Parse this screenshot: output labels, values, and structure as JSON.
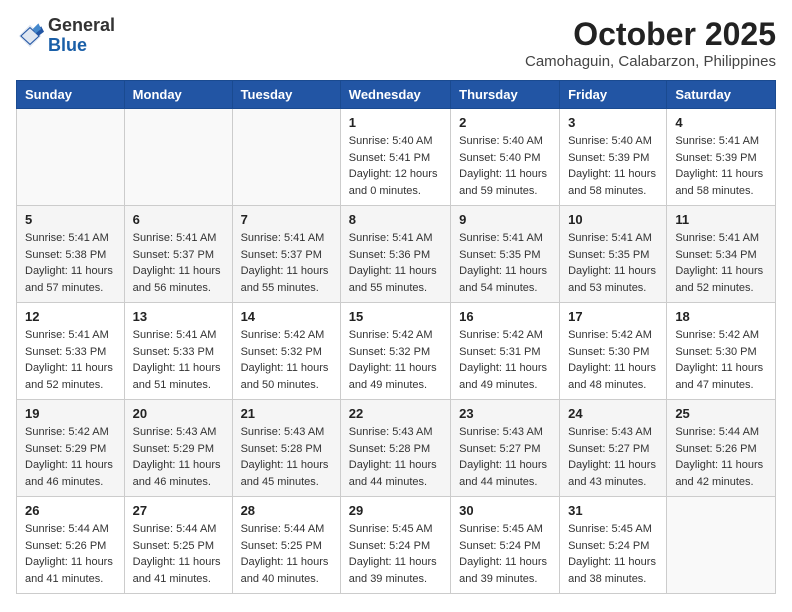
{
  "header": {
    "logo_general": "General",
    "logo_blue": "Blue",
    "month": "October 2025",
    "location": "Camohaguin, Calabarzon, Philippines"
  },
  "days": [
    "Sunday",
    "Monday",
    "Tuesday",
    "Wednesday",
    "Thursday",
    "Friday",
    "Saturday"
  ],
  "weeks": [
    [
      {
        "date": "",
        "sunrise": "",
        "sunset": "",
        "daylight": ""
      },
      {
        "date": "",
        "sunrise": "",
        "sunset": "",
        "daylight": ""
      },
      {
        "date": "",
        "sunrise": "",
        "sunset": "",
        "daylight": ""
      },
      {
        "date": "1",
        "sunrise": "Sunrise: 5:40 AM",
        "sunset": "Sunset: 5:41 PM",
        "daylight": "Daylight: 12 hours and 0 minutes."
      },
      {
        "date": "2",
        "sunrise": "Sunrise: 5:40 AM",
        "sunset": "Sunset: 5:40 PM",
        "daylight": "Daylight: 11 hours and 59 minutes."
      },
      {
        "date": "3",
        "sunrise": "Sunrise: 5:40 AM",
        "sunset": "Sunset: 5:39 PM",
        "daylight": "Daylight: 11 hours and 58 minutes."
      },
      {
        "date": "4",
        "sunrise": "Sunrise: 5:41 AM",
        "sunset": "Sunset: 5:39 PM",
        "daylight": "Daylight: 11 hours and 58 minutes."
      }
    ],
    [
      {
        "date": "5",
        "sunrise": "Sunrise: 5:41 AM",
        "sunset": "Sunset: 5:38 PM",
        "daylight": "Daylight: 11 hours and 57 minutes."
      },
      {
        "date": "6",
        "sunrise": "Sunrise: 5:41 AM",
        "sunset": "Sunset: 5:37 PM",
        "daylight": "Daylight: 11 hours and 56 minutes."
      },
      {
        "date": "7",
        "sunrise": "Sunrise: 5:41 AM",
        "sunset": "Sunset: 5:37 PM",
        "daylight": "Daylight: 11 hours and 55 minutes."
      },
      {
        "date": "8",
        "sunrise": "Sunrise: 5:41 AM",
        "sunset": "Sunset: 5:36 PM",
        "daylight": "Daylight: 11 hours and 55 minutes."
      },
      {
        "date": "9",
        "sunrise": "Sunrise: 5:41 AM",
        "sunset": "Sunset: 5:35 PM",
        "daylight": "Daylight: 11 hours and 54 minutes."
      },
      {
        "date": "10",
        "sunrise": "Sunrise: 5:41 AM",
        "sunset": "Sunset: 5:35 PM",
        "daylight": "Daylight: 11 hours and 53 minutes."
      },
      {
        "date": "11",
        "sunrise": "Sunrise: 5:41 AM",
        "sunset": "Sunset: 5:34 PM",
        "daylight": "Daylight: 11 hours and 52 minutes."
      }
    ],
    [
      {
        "date": "12",
        "sunrise": "Sunrise: 5:41 AM",
        "sunset": "Sunset: 5:33 PM",
        "daylight": "Daylight: 11 hours and 52 minutes."
      },
      {
        "date": "13",
        "sunrise": "Sunrise: 5:41 AM",
        "sunset": "Sunset: 5:33 PM",
        "daylight": "Daylight: 11 hours and 51 minutes."
      },
      {
        "date": "14",
        "sunrise": "Sunrise: 5:42 AM",
        "sunset": "Sunset: 5:32 PM",
        "daylight": "Daylight: 11 hours and 50 minutes."
      },
      {
        "date": "15",
        "sunrise": "Sunrise: 5:42 AM",
        "sunset": "Sunset: 5:32 PM",
        "daylight": "Daylight: 11 hours and 49 minutes."
      },
      {
        "date": "16",
        "sunrise": "Sunrise: 5:42 AM",
        "sunset": "Sunset: 5:31 PM",
        "daylight": "Daylight: 11 hours and 49 minutes."
      },
      {
        "date": "17",
        "sunrise": "Sunrise: 5:42 AM",
        "sunset": "Sunset: 5:30 PM",
        "daylight": "Daylight: 11 hours and 48 minutes."
      },
      {
        "date": "18",
        "sunrise": "Sunrise: 5:42 AM",
        "sunset": "Sunset: 5:30 PM",
        "daylight": "Daylight: 11 hours and 47 minutes."
      }
    ],
    [
      {
        "date": "19",
        "sunrise": "Sunrise: 5:42 AM",
        "sunset": "Sunset: 5:29 PM",
        "daylight": "Daylight: 11 hours and 46 minutes."
      },
      {
        "date": "20",
        "sunrise": "Sunrise: 5:43 AM",
        "sunset": "Sunset: 5:29 PM",
        "daylight": "Daylight: 11 hours and 46 minutes."
      },
      {
        "date": "21",
        "sunrise": "Sunrise: 5:43 AM",
        "sunset": "Sunset: 5:28 PM",
        "daylight": "Daylight: 11 hours and 45 minutes."
      },
      {
        "date": "22",
        "sunrise": "Sunrise: 5:43 AM",
        "sunset": "Sunset: 5:28 PM",
        "daylight": "Daylight: 11 hours and 44 minutes."
      },
      {
        "date": "23",
        "sunrise": "Sunrise: 5:43 AM",
        "sunset": "Sunset: 5:27 PM",
        "daylight": "Daylight: 11 hours and 44 minutes."
      },
      {
        "date": "24",
        "sunrise": "Sunrise: 5:43 AM",
        "sunset": "Sunset: 5:27 PM",
        "daylight": "Daylight: 11 hours and 43 minutes."
      },
      {
        "date": "25",
        "sunrise": "Sunrise: 5:44 AM",
        "sunset": "Sunset: 5:26 PM",
        "daylight": "Daylight: 11 hours and 42 minutes."
      }
    ],
    [
      {
        "date": "26",
        "sunrise": "Sunrise: 5:44 AM",
        "sunset": "Sunset: 5:26 PM",
        "daylight": "Daylight: 11 hours and 41 minutes."
      },
      {
        "date": "27",
        "sunrise": "Sunrise: 5:44 AM",
        "sunset": "Sunset: 5:25 PM",
        "daylight": "Daylight: 11 hours and 41 minutes."
      },
      {
        "date": "28",
        "sunrise": "Sunrise: 5:44 AM",
        "sunset": "Sunset: 5:25 PM",
        "daylight": "Daylight: 11 hours and 40 minutes."
      },
      {
        "date": "29",
        "sunrise": "Sunrise: 5:45 AM",
        "sunset": "Sunset: 5:24 PM",
        "daylight": "Daylight: 11 hours and 39 minutes."
      },
      {
        "date": "30",
        "sunrise": "Sunrise: 5:45 AM",
        "sunset": "Sunset: 5:24 PM",
        "daylight": "Daylight: 11 hours and 39 minutes."
      },
      {
        "date": "31",
        "sunrise": "Sunrise: 5:45 AM",
        "sunset": "Sunset: 5:24 PM",
        "daylight": "Daylight: 11 hours and 38 minutes."
      },
      {
        "date": "",
        "sunrise": "",
        "sunset": "",
        "daylight": ""
      }
    ]
  ]
}
